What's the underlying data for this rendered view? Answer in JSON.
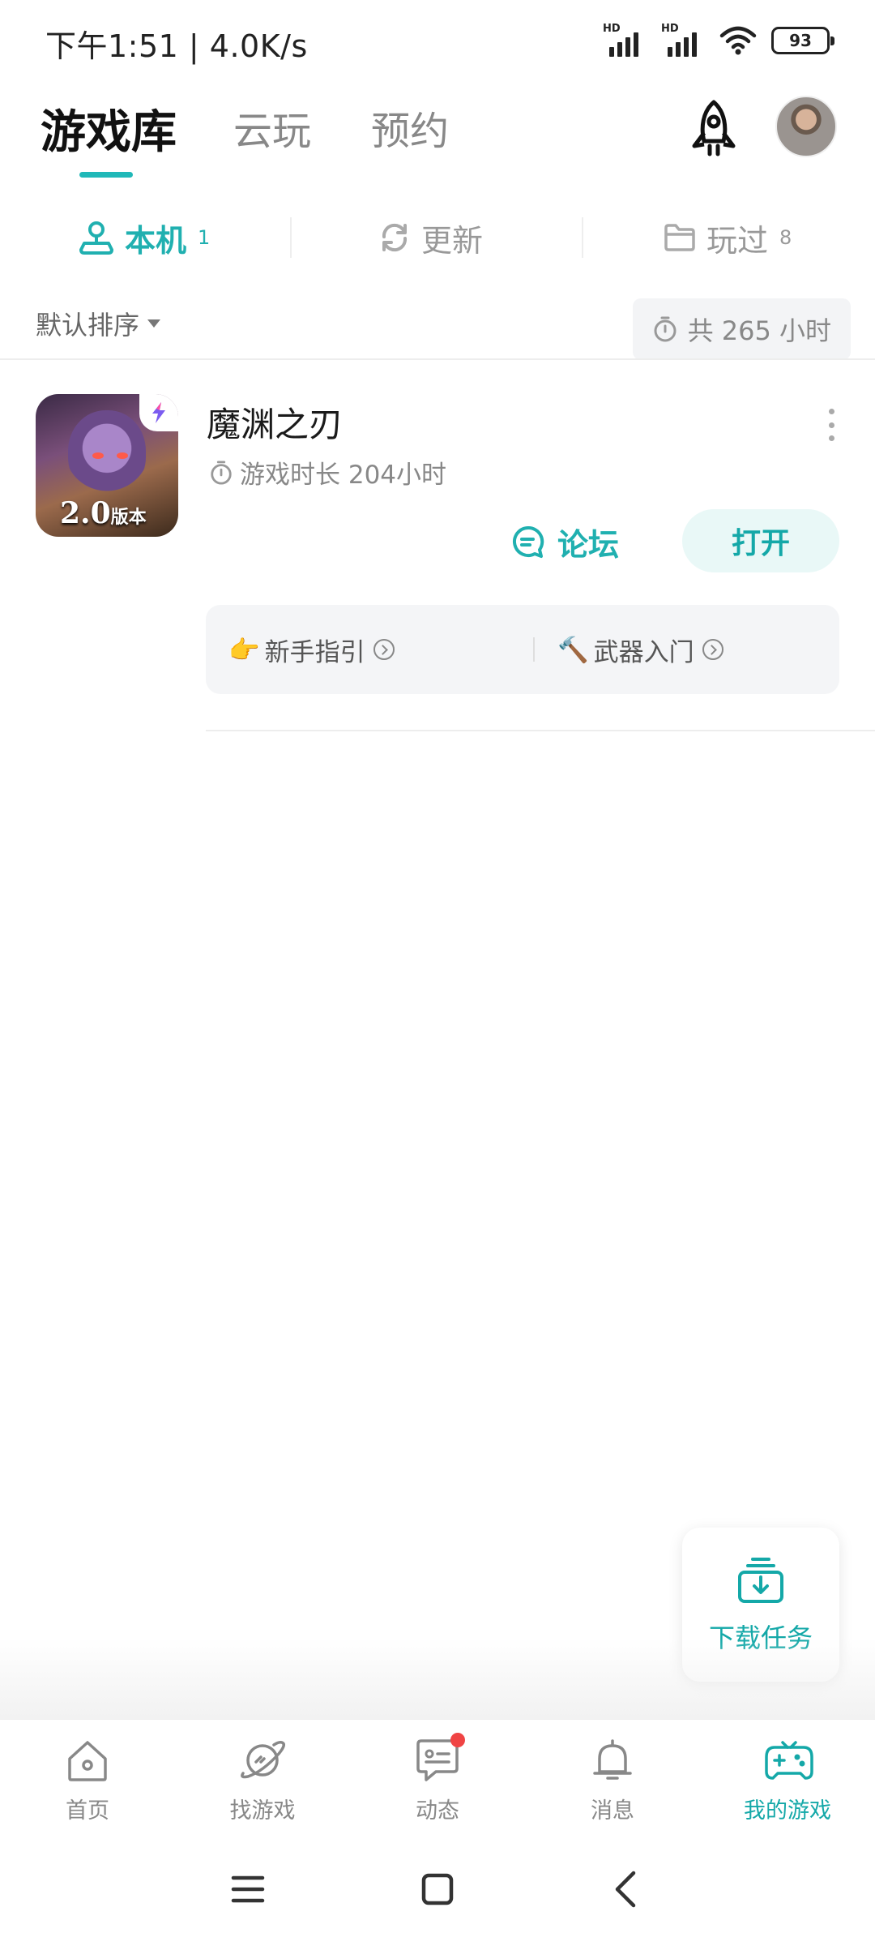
{
  "status_bar": {
    "time": "下午1:51 | 4.0K/s",
    "signal1_label": "HD",
    "signal2_label": "HD",
    "battery": "93"
  },
  "header": {
    "tabs": [
      {
        "label": "游戏库"
      },
      {
        "label": "云玩"
      },
      {
        "label": "预约"
      }
    ]
  },
  "sub_tabs": [
    {
      "label": "本机",
      "count": "1"
    },
    {
      "label": "更新",
      "count": ""
    },
    {
      "label": "玩过",
      "count": "8"
    }
  ],
  "sort": {
    "label": "默认排序",
    "total_time": "共 265 小时"
  },
  "game": {
    "title": "魔渊之刃",
    "playtime": "游戏时长 204小时",
    "icon_badge_main": "2.0",
    "icon_badge_suffix": "版本",
    "forum_label": "论坛",
    "open_label": "打开",
    "guides": [
      {
        "emoji": "👉",
        "label": "新手指引"
      },
      {
        "emoji": "🔨",
        "label": "武器入门"
      }
    ]
  },
  "download_task": {
    "label": "下载任务"
  },
  "bottom_nav": [
    {
      "label": "首页",
      "icon": "home-icon"
    },
    {
      "label": "找游戏",
      "icon": "planet-icon"
    },
    {
      "label": "动态",
      "icon": "chat-icon"
    },
    {
      "label": "消息",
      "icon": "bell-icon"
    },
    {
      "label": "我的游戏",
      "icon": "gamepad-icon"
    }
  ],
  "colors": {
    "accent": "#20b0b0",
    "accent_bg": "#e9f8f7",
    "notification": "#f04444"
  }
}
